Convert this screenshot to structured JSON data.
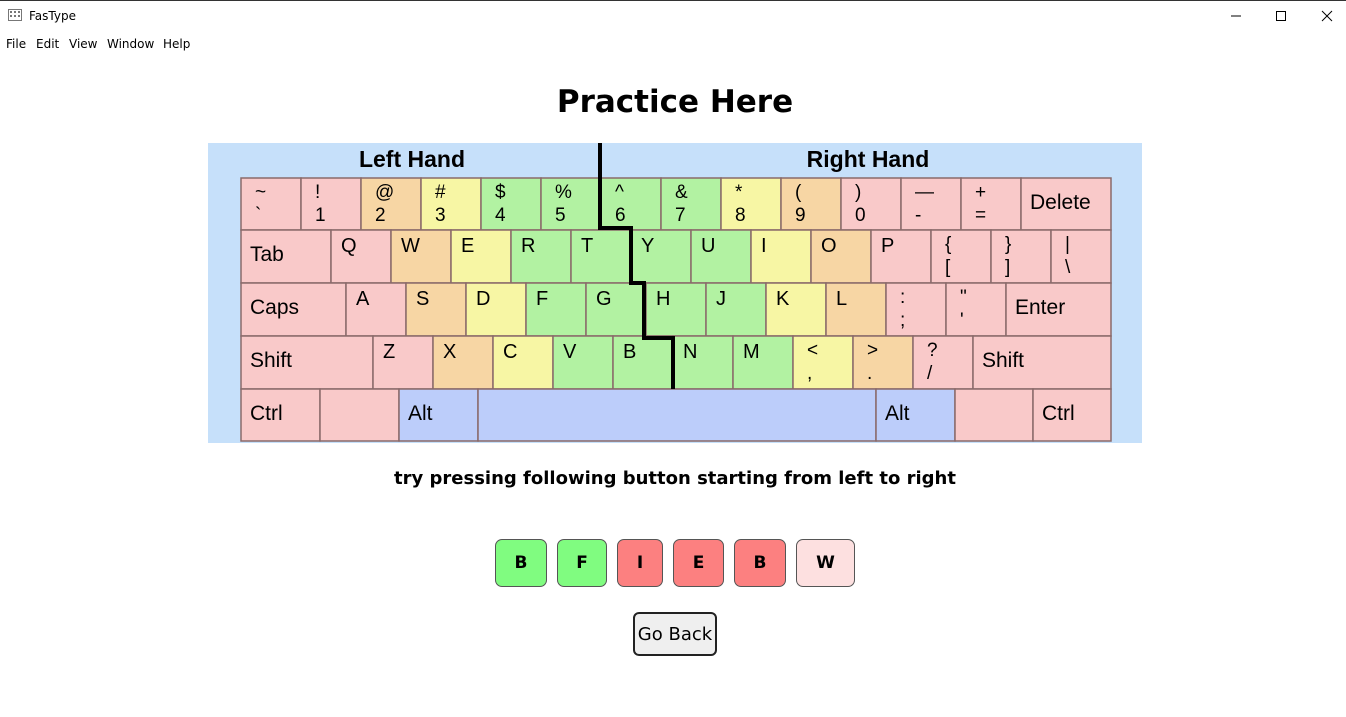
{
  "window": {
    "title": "FasType"
  },
  "menu": {
    "items": [
      "File",
      "Edit",
      "View",
      "Window",
      "Help"
    ]
  },
  "heading": "Practice Here",
  "keyboard": {
    "left_label": "Left Hand",
    "right_label": "Right Hand",
    "rows": [
      [
        [
          "~",
          "`"
        ],
        [
          "!",
          "1"
        ],
        [
          "@",
          "2"
        ],
        [
          "#",
          "3"
        ],
        [
          "$",
          "4"
        ],
        [
          "%",
          "5"
        ],
        [
          "^",
          "6"
        ],
        [
          "&",
          "7"
        ],
        [
          "*",
          "8"
        ],
        [
          "(",
          "9"
        ],
        [
          ")",
          "0"
        ],
        [
          "—",
          "-"
        ],
        [
          "+",
          "="
        ],
        [
          "Delete",
          ""
        ]
      ],
      [
        [
          "Tab",
          ""
        ],
        [
          "Q",
          ""
        ],
        [
          "W",
          ""
        ],
        [
          "E",
          ""
        ],
        [
          "R",
          ""
        ],
        [
          "T",
          ""
        ],
        [
          "Y",
          ""
        ],
        [
          "U",
          ""
        ],
        [
          "I",
          ""
        ],
        [
          "O",
          ""
        ],
        [
          "P",
          ""
        ],
        [
          "{",
          "["
        ],
        [
          "}",
          "]"
        ],
        [
          "|",
          "\\"
        ]
      ],
      [
        [
          "Caps",
          ""
        ],
        [
          "A",
          ""
        ],
        [
          "S",
          ""
        ],
        [
          "D",
          ""
        ],
        [
          "F",
          ""
        ],
        [
          "G",
          ""
        ],
        [
          "H",
          ""
        ],
        [
          "J",
          ""
        ],
        [
          "K",
          ""
        ],
        [
          "L",
          ""
        ],
        [
          ":",
          ";"
        ],
        [
          "\"",
          "'"
        ],
        [
          "Enter",
          ""
        ]
      ],
      [
        [
          "Shift",
          ""
        ],
        [
          "Z",
          ""
        ],
        [
          "X",
          ""
        ],
        [
          "C",
          ""
        ],
        [
          "V",
          ""
        ],
        [
          "B",
          ""
        ],
        [
          "N",
          ""
        ],
        [
          "M",
          ""
        ],
        [
          "<",
          ","
        ],
        [
          ">",
          "."
        ],
        [
          "?",
          "/"
        ],
        [
          "Shift",
          ""
        ]
      ],
      [
        [
          "Ctrl",
          ""
        ],
        [
          "",
          ""
        ],
        [
          "Alt",
          ""
        ],
        [
          "",
          ""
        ],
        [
          "Alt",
          ""
        ],
        [
          "",
          ""
        ],
        [
          "Ctrl",
          ""
        ]
      ]
    ]
  },
  "instruction": "try pressing following button starting from left to right",
  "sequence": [
    {
      "label": "B",
      "state": "correct",
      "color": "#80fc80"
    },
    {
      "label": "F",
      "state": "correct",
      "color": "#80fc80"
    },
    {
      "label": "I",
      "state": "wrong",
      "color": "#fc8080"
    },
    {
      "label": "E",
      "state": "wrong",
      "color": "#fc8080"
    },
    {
      "label": "B",
      "state": "wrong",
      "color": "#fc8080"
    },
    {
      "label": "W",
      "state": "pending",
      "color": "#fde0e0"
    }
  ],
  "go_back_label": "Go Back"
}
